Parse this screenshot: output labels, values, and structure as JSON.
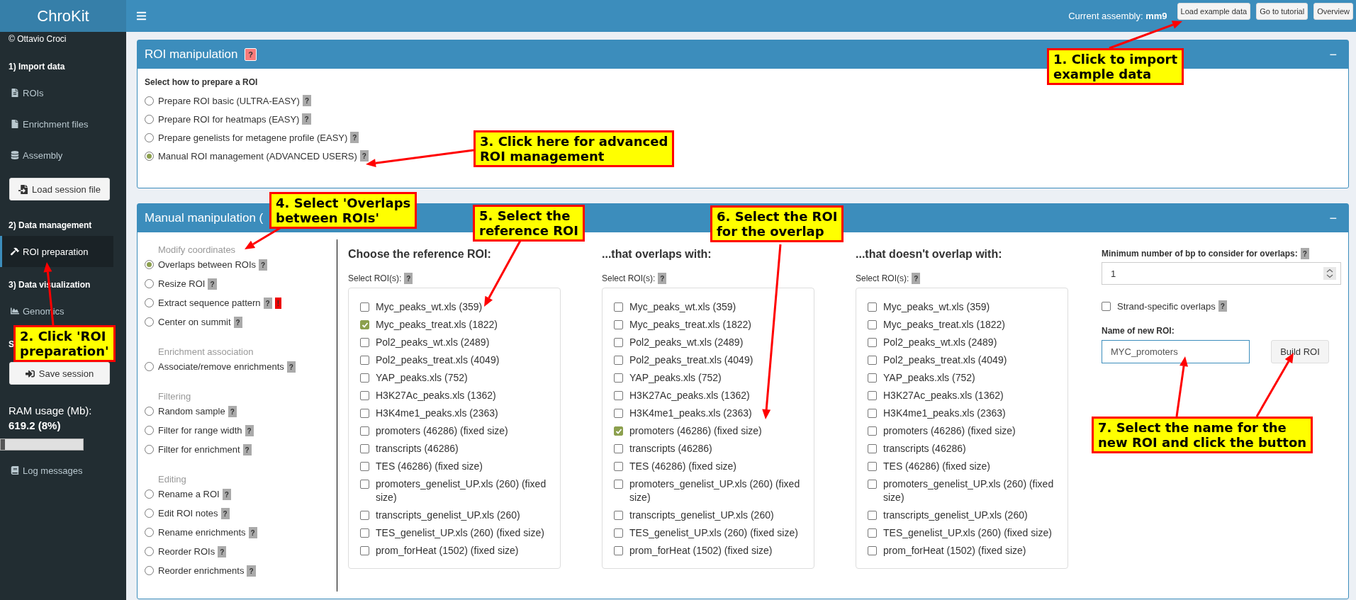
{
  "brand": {
    "title": "ChroKit"
  },
  "sidebar": {
    "items": [
      {
        "kind": "author",
        "label": "© Ottavio Croci"
      },
      {
        "kind": "section",
        "label": "1) Import data"
      },
      {
        "kind": "link",
        "label": "ROIs",
        "selected": false
      },
      {
        "kind": "link",
        "label": "Enrichment files",
        "selected": false
      },
      {
        "kind": "link",
        "label": "Assembly",
        "selected": false
      },
      {
        "kind": "button",
        "label": "Load session file"
      },
      {
        "kind": "section",
        "label": "2) Data management"
      },
      {
        "kind": "link",
        "label": "ROI preparation",
        "selected": true
      },
      {
        "kind": "section",
        "label": "3) Data visualization"
      },
      {
        "kind": "link",
        "label": "Genomics",
        "selected": false
      },
      {
        "kind": "section",
        "label": "S"
      },
      {
        "kind": "button",
        "label": "Save session"
      },
      {
        "kind": "stat_label",
        "label": "RAM usage (Mb):"
      },
      {
        "kind": "stat_value",
        "label": "619.2 (8%)"
      },
      {
        "kind": "progress",
        "level": 0.05
      },
      {
        "kind": "link",
        "label": "Log messages",
        "selected": false
      }
    ]
  },
  "topbar": {
    "assembly": "Current assembly: **mm9**",
    "buttons": [
      "Load example data",
      "Go to tutorial",
      "Overview"
    ]
  },
  "roi_box": {
    "title": "ROI manipulation",
    "help": "?",
    "collapse": "−",
    "prompt": "Select how to prepare a ROI",
    "options": [
      {
        "label": "Prepare ROI basic (ULTRA-EASY)",
        "help": "?",
        "selected": false
      },
      {
        "label": "Prepare ROI for heatmaps (EASY)",
        "help": "?",
        "selected": false
      },
      {
        "label": "Prepare genelists for metagene profile (EASY)",
        "help": "?",
        "selected": false
      },
      {
        "label": "Manual ROI management (ADVANCED USERS)",
        "help": "?",
        "selected": true
      }
    ]
  },
  "manual_box": {
    "title": "Manual manipulation (",
    "collapse": "−",
    "groups": [
      {
        "heading": "Modify coordinates",
        "options": [
          {
            "label": "Overlaps between ROIs",
            "help": "?",
            "selected": true
          },
          {
            "label": "Resize ROI",
            "help": "?",
            "selected": false
          },
          {
            "label": "Extract sequence pattern",
            "help": "?",
            "warning": "!",
            "selected": false
          },
          {
            "label": "Center on summit",
            "help": "?",
            "selected": false
          }
        ]
      },
      {
        "heading": "Enrichment association",
        "options": [
          {
            "label": "Associate/remove enrichments",
            "help": "?",
            "selected": false
          }
        ]
      },
      {
        "heading": "Filtering",
        "options": [
          {
            "label": "Random sample",
            "help": "?",
            "selected": false
          },
          {
            "label": "Filter for range width",
            "help": "?",
            "selected": false
          },
          {
            "label": "Filter for enrichment",
            "help": "?",
            "selected": false
          }
        ]
      },
      {
        "heading": "Editing",
        "options": [
          {
            "label": "Rename a ROI",
            "help": "?",
            "selected": false
          },
          {
            "label": "Edit ROI notes",
            "help": "?",
            "selected": false
          },
          {
            "label": "Rename enrichments",
            "help": "?",
            "selected": false
          },
          {
            "label": "Reorder ROIs",
            "help": "?",
            "selected": false
          },
          {
            "label": "Reorder enrichments",
            "help": "?",
            "selected": false
          }
        ]
      }
    ],
    "columns": [
      {
        "title": "Choose the reference ROI:",
        "select_label": "Select ROI(s):",
        "help": "?",
        "items": [
          {
            "label": "Myc_peaks_wt.xls (359)",
            "checked": false
          },
          {
            "label": "Myc_peaks_treat.xls (1822)",
            "checked": true
          },
          {
            "label": "Pol2_peaks_wt.xls (2489)",
            "checked": false
          },
          {
            "label": "Pol2_peaks_treat.xls (4049)",
            "checked": false
          },
          {
            "label": "YAP_peaks.xls (752)",
            "checked": false
          },
          {
            "label": "H3K27Ac_peaks.xls (1362)",
            "checked": false
          },
          {
            "label": "H3K4me1_peaks.xls (2363)",
            "checked": false
          },
          {
            "label": "promoters (46286) (fixed size)",
            "checked": false
          },
          {
            "label": "transcripts (46286)",
            "checked": false
          },
          {
            "label": "TES (46286) (fixed size)",
            "checked": false
          },
          {
            "label": "promoters_genelist_UP.xls (260) (fixed size)",
            "checked": false
          },
          {
            "label": "transcripts_genelist_UP.xls (260)",
            "checked": false
          },
          {
            "label": "TES_genelist_UP.xls (260) (fixed size)",
            "checked": false
          },
          {
            "label": "prom_forHeat (1502) (fixed size)",
            "checked": false
          }
        ]
      },
      {
        "title": "...that overlaps with:",
        "select_label": "Select ROI(s):",
        "help": "?",
        "items": [
          {
            "label": "Myc_peaks_wt.xls (359)",
            "checked": false
          },
          {
            "label": "Myc_peaks_treat.xls (1822)",
            "checked": false
          },
          {
            "label": "Pol2_peaks_wt.xls (2489)",
            "checked": false
          },
          {
            "label": "Pol2_peaks_treat.xls (4049)",
            "checked": false
          },
          {
            "label": "YAP_peaks.xls (752)",
            "checked": false
          },
          {
            "label": "H3K27Ac_peaks.xls (1362)",
            "checked": false
          },
          {
            "label": "H3K4me1_peaks.xls (2363)",
            "checked": false
          },
          {
            "label": "promoters (46286) (fixed size)",
            "checked": true
          },
          {
            "label": "transcripts (46286)",
            "checked": false
          },
          {
            "label": "TES (46286) (fixed size)",
            "checked": false
          },
          {
            "label": "promoters_genelist_UP.xls (260) (fixed size)",
            "checked": false
          },
          {
            "label": "transcripts_genelist_UP.xls (260)",
            "checked": false
          },
          {
            "label": "TES_genelist_UP.xls (260) (fixed size)",
            "checked": false
          },
          {
            "label": "prom_forHeat (1502) (fixed size)",
            "checked": false
          }
        ]
      },
      {
        "title": "...that doesn't overlap with:",
        "select_label": "Select ROI(s):",
        "help": "?",
        "items": [
          {
            "label": "Myc_peaks_wt.xls (359)",
            "checked": false
          },
          {
            "label": "Myc_peaks_treat.xls (1822)",
            "checked": false
          },
          {
            "label": "Pol2_peaks_wt.xls (2489)",
            "checked": false
          },
          {
            "label": "Pol2_peaks_treat.xls (4049)",
            "checked": false
          },
          {
            "label": "YAP_peaks.xls (752)",
            "checked": false
          },
          {
            "label": "H3K27Ac_peaks.xls (1362)",
            "checked": false
          },
          {
            "label": "H3K4me1_peaks.xls (2363)",
            "checked": false
          },
          {
            "label": "promoters (46286) (fixed size)",
            "checked": false
          },
          {
            "label": "transcripts (46286)",
            "checked": false
          },
          {
            "label": "TES (46286) (fixed size)",
            "checked": false
          },
          {
            "label": "promoters_genelist_UP.xls (260) (fixed size)",
            "checked": false
          },
          {
            "label": "transcripts_genelist_UP.xls (260)",
            "checked": false
          },
          {
            "label": "TES_genelist_UP.xls (260) (fixed size)",
            "checked": false
          },
          {
            "label": "prom_forHeat (1502) (fixed size)",
            "checked": false
          }
        ]
      }
    ],
    "settings": {
      "min_bp_label": "Minimum number of bp to consider for overlaps:",
      "min_bp_help": "?",
      "min_bp_value": "1",
      "strand_label": "Strand-specific overlaps",
      "strand_help": "?",
      "strand_checked": false,
      "name_label": "Name of new ROI:",
      "name_value": "MYC_promoters",
      "build_button": "Build ROI"
    }
  },
  "callouts": [
    {
      "lines": [
        "1. Click to import",
        "example data"
      ]
    },
    {
      "lines": [
        "2. Click 'ROI",
        "preparation'"
      ]
    },
    {
      "lines": [
        "3. Click here for advanced",
        "ROI management"
      ]
    },
    {
      "lines": [
        "4. Select 'Overlaps",
        "between ROIs'"
      ]
    },
    {
      "lines": [
        "5. Select the",
        "reference ROI"
      ]
    },
    {
      "lines": [
        "6. Select the ROI",
        "for the overlap"
      ]
    },
    {
      "lines": [
        "7. Select the name for the",
        "new ROI and click the button"
      ]
    }
  ]
}
